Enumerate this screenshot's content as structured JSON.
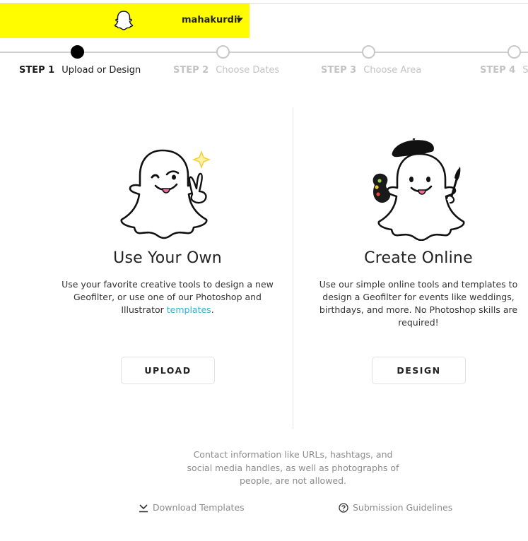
{
  "header": {
    "username": "mahakurdii",
    "accent_color": "#fffc00",
    "logo_icon": "snapchat-ghost-icon",
    "menu_icon": "caret-down-icon"
  },
  "steps": [
    {
      "number": "STEP 1",
      "label": "Upload or Design",
      "active": true
    },
    {
      "number": "STEP 2",
      "label": "Choose Dates",
      "active": false
    },
    {
      "number": "STEP 3",
      "label": "Choose Area",
      "active": false
    },
    {
      "number": "STEP 4",
      "label": "Su",
      "active": false
    }
  ],
  "options": {
    "upload": {
      "title": "Use Your Own",
      "description": "Use your favorite creative tools to design a new Geofilter, or use one of our Photoshop and Illustrator ",
      "link_text": "templates",
      "description_end": ".",
      "button_label": "UPLOAD",
      "illustration": "winking-ghost-peace-sign"
    },
    "design": {
      "title": "Create Online",
      "description": "Use our simple online tools and templates to design a Geofilter for events like weddings, birthdays, and more. No Photoshop skills are required!",
      "button_label": "DESIGN",
      "illustration": "artist-ghost-beret-palette"
    }
  },
  "notice": "Contact information like URLs, hashtags, and social media handles, as well as photographs of people, are not allowed.",
  "footer": {
    "download_label": "Download Templates",
    "download_icon": "download-icon",
    "guidelines_label": "Submission Guidelines",
    "guidelines_icon": "help-circle-icon"
  },
  "link_color": "#32b0d8"
}
